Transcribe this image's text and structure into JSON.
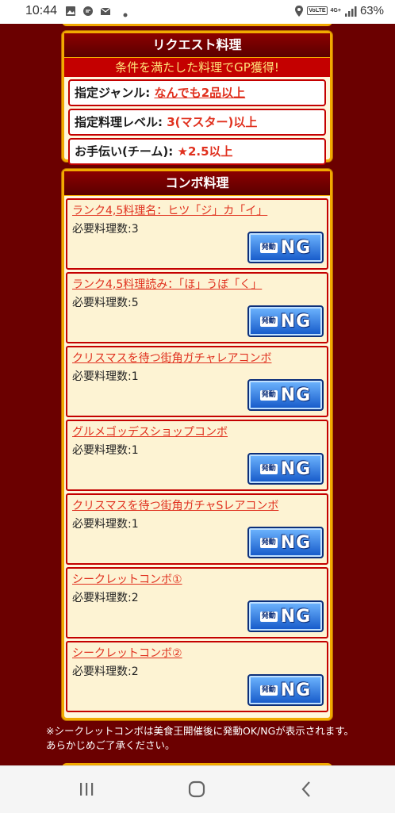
{
  "status_bar": {
    "time": "10:44",
    "volte": "VoLTE",
    "network": "4G+",
    "battery": "63%"
  },
  "request_panel": {
    "title": "リクエスト料理",
    "subtitle": "条件を満たした料理でGP獲得!",
    "rows": [
      {
        "label": "指定ジャンル:",
        "value": "なんでも2品以上"
      },
      {
        "label": "指定料理レベル:",
        "value": "3(マスター)以上"
      },
      {
        "label": "お手伝い(チーム):",
        "star": "★",
        "value": "2.5以上"
      }
    ]
  },
  "combo_panel": {
    "title": "コンボ料理",
    "items": [
      {
        "name": "ランク4,5料理名：ヒツ「ジ」カ「イ」",
        "req": "必要料理数:3",
        "hatsudo": "発動",
        "status": "NG"
      },
      {
        "name": "ランク4,5料理読み：「ほ」うぼ「く」",
        "req": "必要料理数:5",
        "hatsudo": "発動",
        "status": "NG"
      },
      {
        "name": "クリスマスを待つ街角ガチャレアコンボ",
        "req": "必要料理数:1",
        "hatsudo": "発動",
        "status": "NG"
      },
      {
        "name": "グルメゴッデスショップコンボ",
        "req": "必要料理数:1",
        "hatsudo": "発動",
        "status": "NG"
      },
      {
        "name": "クリスマスを待つ街角ガチャSレアコンボ",
        "req": "必要料理数:1",
        "hatsudo": "発動",
        "status": "NG"
      },
      {
        "name": "シークレットコンボ①",
        "req": "必要料理数:2",
        "hatsudo": "発動",
        "status": "NG"
      },
      {
        "name": "シークレットコンボ②",
        "req": "必要料理数:2",
        "hatsudo": "発動",
        "status": "NG"
      }
    ]
  },
  "note": "※シークレットコンボは美食王開催後に発動OK/NGが表示されます。あらかじめご了承ください。",
  "nav_bar": {
    "recents_icon": "recents-icon",
    "home_icon": "home-icon",
    "back_icon": "back-icon"
  },
  "colors": {
    "background": "#6b0000",
    "panel_border": "#f2a900",
    "accent_red": "#e0301e",
    "ng_button": "#1357c8"
  }
}
